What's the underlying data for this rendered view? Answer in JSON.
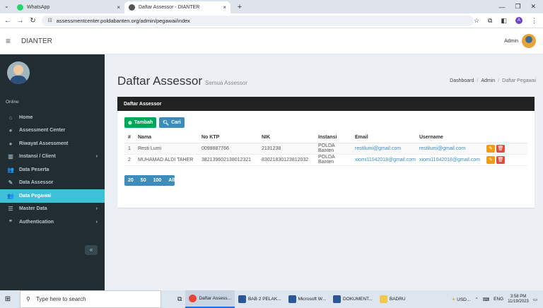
{
  "browser": {
    "tabs": [
      {
        "label": "WhatsApp",
        "close": "×"
      },
      {
        "label": "Daftar Assessor - DIANTER",
        "close": "×"
      }
    ],
    "url": "assessmentcenter.poldabanten.org/admin/pegawai/index",
    "profile_initial": "A"
  },
  "topbar": {
    "brand": "DIANTER",
    "user": "Admin"
  },
  "sidebar": {
    "status": "Online",
    "items": [
      {
        "label": "Home",
        "icon": "home-icon"
      },
      {
        "label": "Assessment Center",
        "icon": "circle-icon"
      },
      {
        "label": "Riwayat Assessment",
        "icon": "circle-icon"
      },
      {
        "label": "Instansi / Client",
        "icon": "building-icon",
        "arrow": "›"
      },
      {
        "label": "Data Peserta",
        "icon": "users-icon"
      },
      {
        "label": "Data Assessor",
        "icon": "user-edit-icon"
      },
      {
        "label": "Data Pegawai",
        "icon": "users-icon"
      },
      {
        "label": "Master Data",
        "icon": "database-icon",
        "arrow": "›"
      },
      {
        "label": "Authentication",
        "icon": "quote-icon",
        "arrow": "›"
      }
    ],
    "collapse": "«"
  },
  "page": {
    "title": "Daftar Assessor",
    "subtitle": "Semua Assessor",
    "breadcrumb": [
      "Dashboard",
      "Admin",
      "Daftar Pegawai"
    ]
  },
  "box": {
    "title": "Daftar Assessor",
    "add_label": "Tambah",
    "search_label": "Cari",
    "columns": [
      "#",
      "Nama",
      "No KTP",
      "NIK",
      "Instansi",
      "Email",
      "Username",
      ""
    ],
    "rows": [
      {
        "no": "1",
        "nama": "Resti Lumi",
        "ktp": "0099887766",
        "nik": "2131238",
        "instansi": "POLDA Banten",
        "email": "restilumi@gmail.com",
        "username": "restilumi@gmail.com"
      },
      {
        "no": "2",
        "nama": "MUHAMAD ALDI TAHER",
        "ktp": "382139602138012321",
        "nik": "83021830123812032",
        "instansi": "POLDA Banten",
        "email": "xiomi11042018@gmail.com",
        "username": "xiomi11042018@gmail.com"
      }
    ],
    "page_sizes": [
      "20",
      "50",
      "100",
      "All"
    ]
  },
  "taskbar": {
    "search_placeholder": "Type here to search",
    "apps": [
      {
        "label": "Daftar Assess...",
        "color": "#e8453c"
      },
      {
        "label": "BAB 2 PELAK...",
        "color": "#2b5797"
      },
      {
        "label": "Microsoft W...",
        "color": "#2b5797"
      },
      {
        "label": "DOKUMENT...",
        "color": "#2b5797"
      },
      {
        "label": "BADRU",
        "color": "#f2c94c"
      }
    ],
    "weather": "USD...",
    "lang": "ENG",
    "time": "3:58 PM",
    "date": "11/19/2023"
  },
  "colors": {
    "active": "#3ec0d8",
    "sidebar": "#222d32",
    "green": "#00a65a",
    "blue": "#3c8dbc"
  }
}
